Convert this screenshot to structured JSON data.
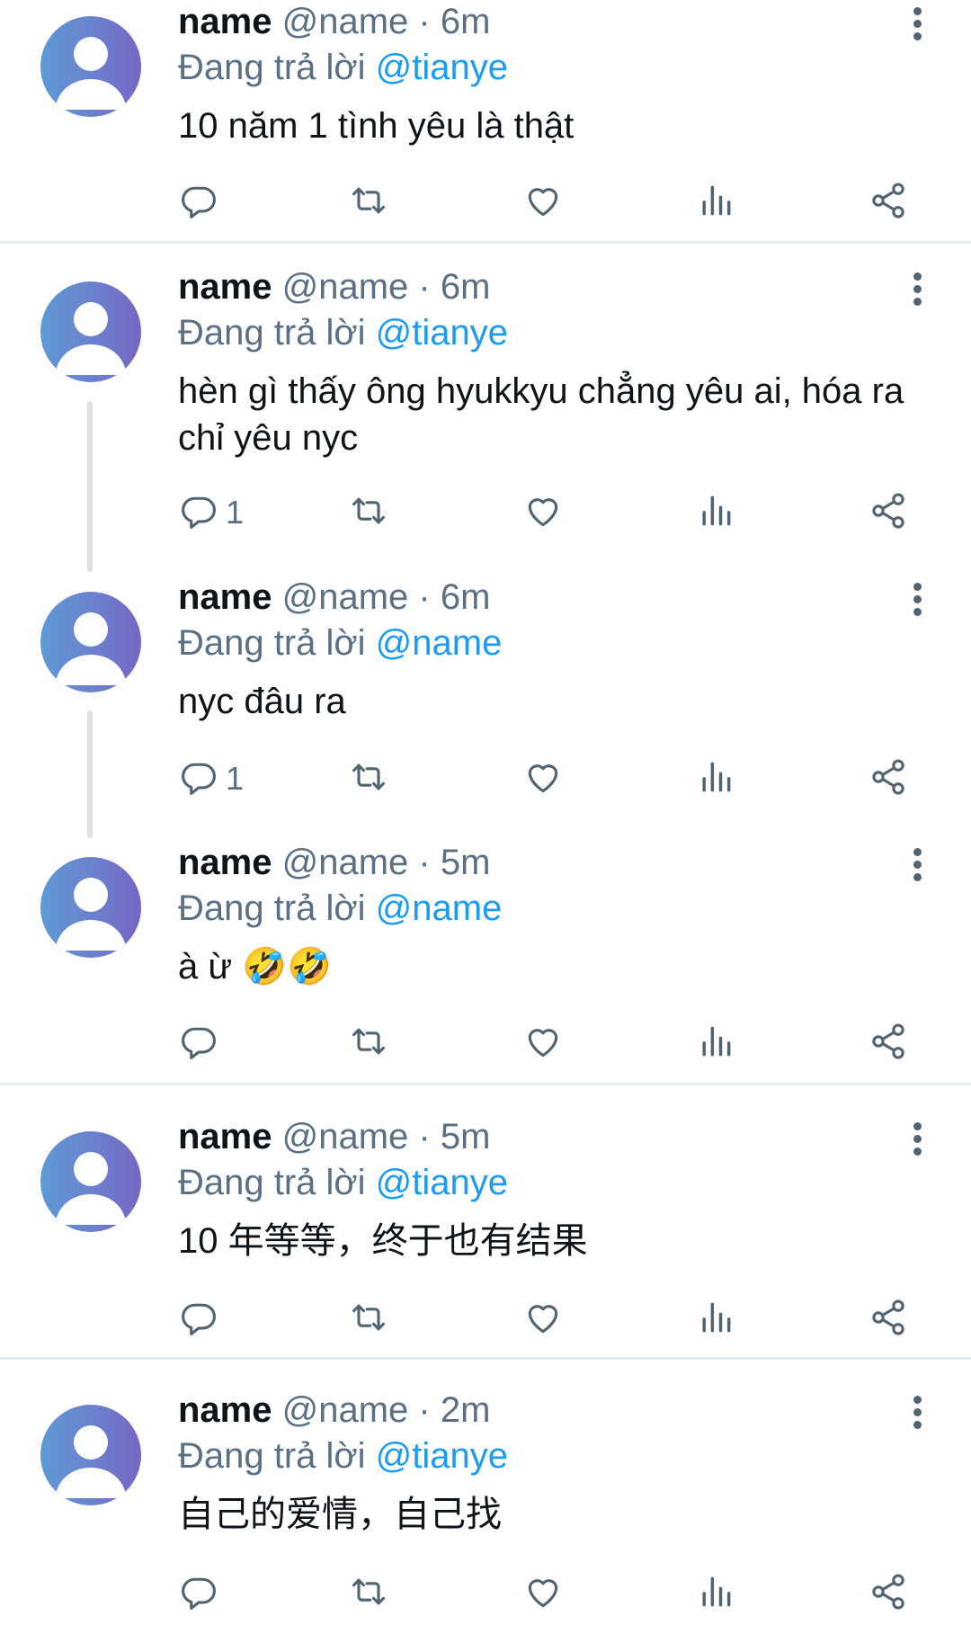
{
  "reply_prefix": "Đang trả lời",
  "tweets": [
    {
      "name": "name",
      "handle": "@name",
      "time": "6m",
      "reply_to": "@tianye",
      "text": "10 năm 1 tình yêu là thật",
      "reply_count": ""
    },
    {
      "name": "name",
      "handle": "@name",
      "time": "6m",
      "reply_to": "@tianye",
      "text": "hèn gì thấy ông hyukkyu chẳng yêu ai, hóa ra chỉ yêu nyc",
      "reply_count": "1"
    },
    {
      "name": "name",
      "handle": "@name",
      "time": "6m",
      "reply_to": "@name",
      "text": "nyc đâu ra",
      "reply_count": "1"
    },
    {
      "name": "name",
      "handle": "@name",
      "time": "5m",
      "reply_to": "@name",
      "text": "à ừ",
      "emoji": "🤣🤣",
      "reply_count": ""
    },
    {
      "name": "name",
      "handle": "@name",
      "time": "5m",
      "reply_to": "@tianye",
      "text": "10 年等等，终于也有结果",
      "reply_count": ""
    },
    {
      "name": "name",
      "handle": "@name",
      "time": "2m",
      "reply_to": "@tianye",
      "text": "自己的爱情，自己找",
      "reply_count": ""
    }
  ],
  "icons": [
    "more-icon",
    "reply-icon",
    "retweet-icon",
    "like-icon",
    "stats-icon",
    "share-icon"
  ],
  "colors": {
    "link": "#1d9bf0",
    "secondary": "#5b7083",
    "icon": "#536471"
  }
}
